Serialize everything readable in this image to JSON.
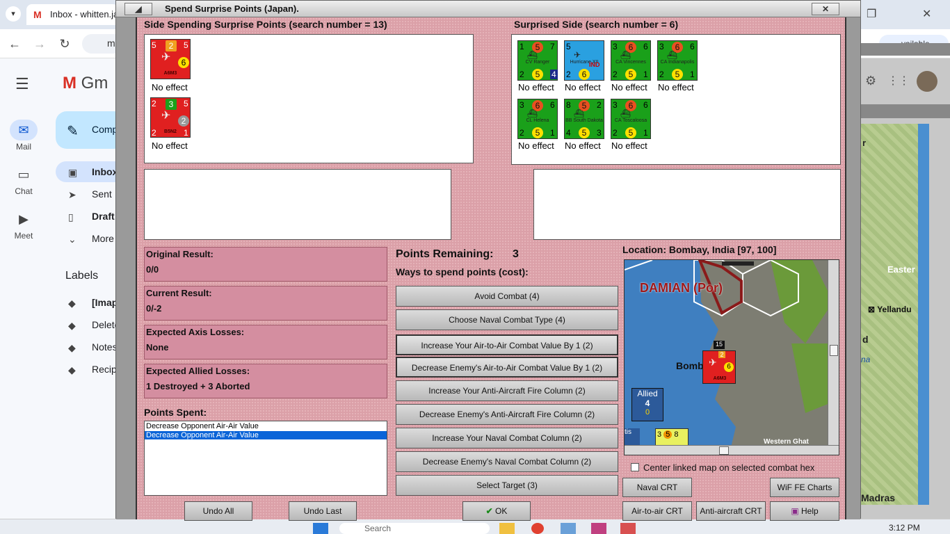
{
  "browser": {
    "tab_title": "Inbox - whitten.ja",
    "tab_icon": "gmail-icon",
    "available_label": "vailable"
  },
  "gmail": {
    "brand": "Gm",
    "compose_label": "Comp",
    "rail": [
      {
        "label": "Mail",
        "icon": "mail-icon"
      },
      {
        "label": "Chat",
        "icon": "chat-icon"
      },
      {
        "label": "Meet",
        "icon": "meet-icon"
      }
    ],
    "folders": [
      "Inbox",
      "Sent",
      "Draft",
      "More"
    ],
    "labels_title": "Labels",
    "labels": [
      "[Imap",
      "Delete",
      "Notes",
      "Recip"
    ]
  },
  "right_map": {
    "texts": [
      "r",
      "Easter",
      "Yellandu",
      "d",
      "na",
      "Madras"
    ]
  },
  "taskbar": {
    "search_placeholder": "Search",
    "time": "3:12 PM"
  },
  "dialog": {
    "title": "Spend Surprise Points (Japan).",
    "left_header": "Side Spending Surprise Points (search number = 13)",
    "right_header": "Surprised Side (search number = 6)",
    "left_units": [
      {
        "name": "A6M3",
        "tl": "5",
        "top": "2",
        "tr": "5",
        "mid": "6",
        "bl": "2",
        "br": "1",
        "effect": "No effect"
      },
      {
        "name": "B5N2",
        "tl": "2",
        "top": "3",
        "tr": "5",
        "mid": "2",
        "bl": "2",
        "br": "1",
        "effect": "No effect"
      }
    ],
    "right_units": [
      {
        "name": "CV Ranger",
        "tl": "1",
        "top": "5",
        "tr": "7",
        "bl": "2",
        "bm": "5",
        "br": "4",
        "effect": "No effect"
      },
      {
        "name": "Hurricane XII",
        "tl": "5",
        "top": "",
        "tr": "",
        "bl": "2",
        "bm": "6",
        "br": "",
        "tag": "IND",
        "effect": "No effect"
      },
      {
        "name": "CA Vincennes",
        "tl": "3",
        "top": "6",
        "tr": "6",
        "bl": "2",
        "bm": "5",
        "br": "1",
        "effect": "No effect"
      },
      {
        "name": "CA Indianapolis",
        "tl": "3",
        "top": "6",
        "tr": "6",
        "bl": "2",
        "bm": "5",
        "br": "1",
        "effect": "No effect"
      },
      {
        "name": "CL Helena",
        "tl": "3",
        "top": "6",
        "tr": "6",
        "bl": "2",
        "bm": "5",
        "br": "1",
        "effect": "No effect"
      },
      {
        "name": "BB South Dakota",
        "tl": "8",
        "top": "5",
        "tr": "2",
        "bl": "4",
        "bm": "5",
        "br": "3",
        "effect": "No effect"
      },
      {
        "name": "CA Toscaloosa",
        "tl": "3",
        "top": "6",
        "tr": "6",
        "bl": "2",
        "bm": "5",
        "br": "1",
        "effect": "No effect"
      }
    ],
    "results": [
      {
        "label": "Original Result:",
        "value": "0/0"
      },
      {
        "label": "Current Result:",
        "value": "0/-2"
      },
      {
        "label": "Expected Axis Losses:",
        "value": "None"
      },
      {
        "label": "Expected Allied Losses:",
        "value": "1 Destroyed + 3 Aborted"
      }
    ],
    "points_spent_label": "Points Spent:",
    "points_spent": [
      "Decrease Opponent Air-Air Value",
      "Decrease Opponent Air-Air Value"
    ],
    "points_remaining_label": "Points Remaining:",
    "points_remaining": "3",
    "ways_label": "Ways to spend points (cost):",
    "options": [
      "Avoid Combat (4)",
      "Choose Naval Combat Type (4)",
      "Increase Your Air-to-Air Combat Value By 1 (2)",
      "Decrease Enemy's Air-to-Air Combat Value By 1 (2)",
      "Increase Your Anti-Aircraft Fire Column (2)",
      "Decrease Enemy's Anti-Aircraft Fire Column (2)",
      "Increase Your Naval Combat Column (2)",
      "Decrease Enemy's Naval Combat Column (2)",
      "Select Target (3)"
    ],
    "location": "Location: Bombay, India [97, 100]",
    "map": {
      "region_label": "DAMIAN (Por)",
      "city": "Bomb",
      "allied_label": "Allied",
      "allied_num": "4",
      "allied_zero": "0",
      "stack_count": "15",
      "counter_name": "A6M3",
      "cut_label": "tis",
      "bottom_label": "Western Ghat"
    },
    "center_checkbox_label": "Center linked map on selected combat hex",
    "buttons": {
      "undo_all": "Undo All",
      "undo_last": "Undo Last",
      "ok": "OK",
      "naval_crt": "Naval CRT",
      "wif_fe_charts": "WiF FE Charts",
      "air_to_air_crt": "Air-to-air CRT",
      "anti_aircraft_crt": "Anti-aircraft CRT",
      "help": "Help"
    }
  },
  "colors": {
    "dialog_bg": "#dba0a8",
    "result_box": "#d48ea0",
    "japan_red": "#e02020",
    "us_green": "#1aa01a",
    "raf_blue": "#2aa0e0",
    "selected_row": "#0a64d8"
  }
}
